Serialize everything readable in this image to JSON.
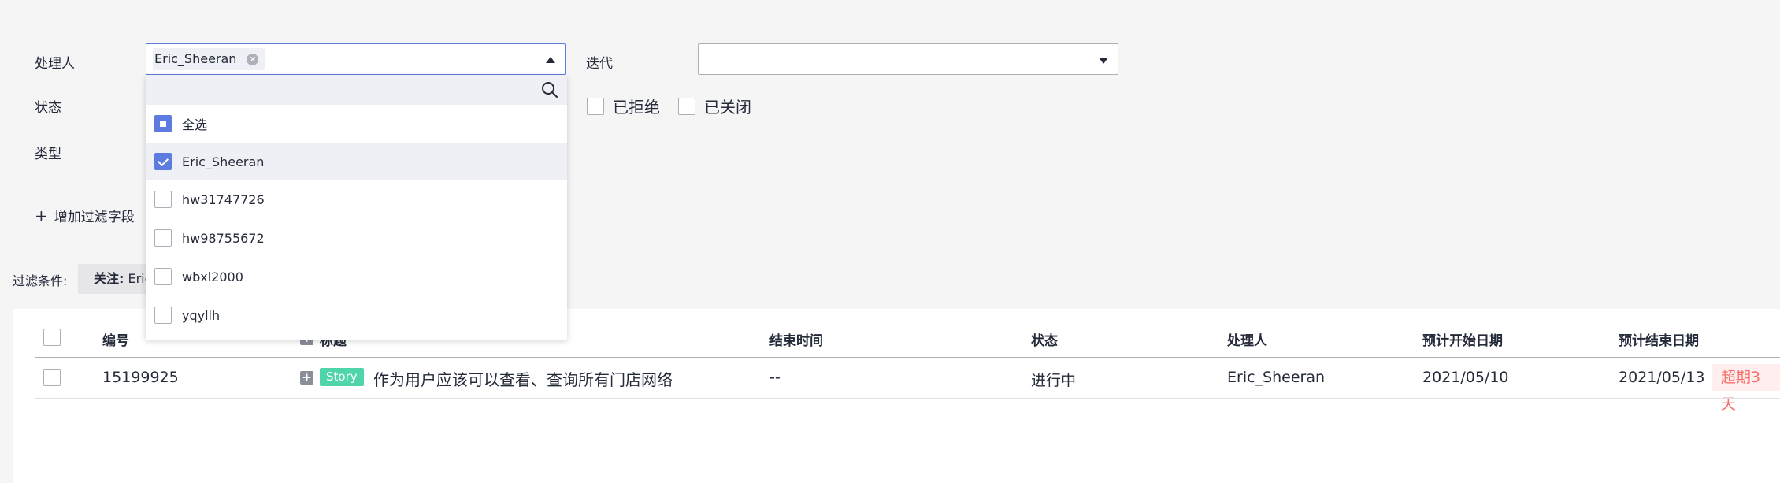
{
  "filters": {
    "assignee_label": "处理人",
    "assignee_tag": "Eric_Sheeran",
    "iteration_label": "迭代",
    "iteration_value": "",
    "status_label": "状态",
    "status_options": [
      "已拒绝",
      "已关闭"
    ],
    "type_label": "类型",
    "add_filter_label": "增加过滤字段"
  },
  "conditions": {
    "label": "过滤条件:",
    "chip_key": "关注:",
    "chip_value": " Eric"
  },
  "dropdown": {
    "search_value": "",
    "options": [
      {
        "label": "全选",
        "state": "partial"
      },
      {
        "label": "Eric_Sheeran",
        "state": "checked"
      },
      {
        "label": "hw31747726",
        "state": "unchecked"
      },
      {
        "label": "hw98755672",
        "state": "unchecked"
      },
      {
        "label": "wbxl2000",
        "state": "unchecked"
      },
      {
        "label": "yqyllh",
        "state": "unchecked"
      }
    ]
  },
  "table": {
    "headers": {
      "id": "编号",
      "title": "标题",
      "end_time": "结束时间",
      "status": "状态",
      "assignee": "处理人",
      "planned_start": "预计开始日期",
      "planned_end": "预计结束日期"
    },
    "rows": [
      {
        "id": "15199925",
        "type_badge": "Story",
        "title": "作为用户应该可以查看、查询所有门店网络",
        "end_time": "--",
        "status": "进行中",
        "assignee": "Eric_Sheeran",
        "planned_start": "2021/05/10",
        "planned_end": "2021/05/13",
        "overdue": "超期3天"
      }
    ]
  },
  "colors": {
    "brand": "#5e7ce0",
    "story_badge": "#50d4ab",
    "overdue_text": "#f66f6a",
    "overdue_bg": "#ffeeed"
  },
  "icons": [
    "clear-icon",
    "chevron-up-icon",
    "chevron-down-icon",
    "search-icon",
    "plus-icon",
    "expand-icon"
  ]
}
